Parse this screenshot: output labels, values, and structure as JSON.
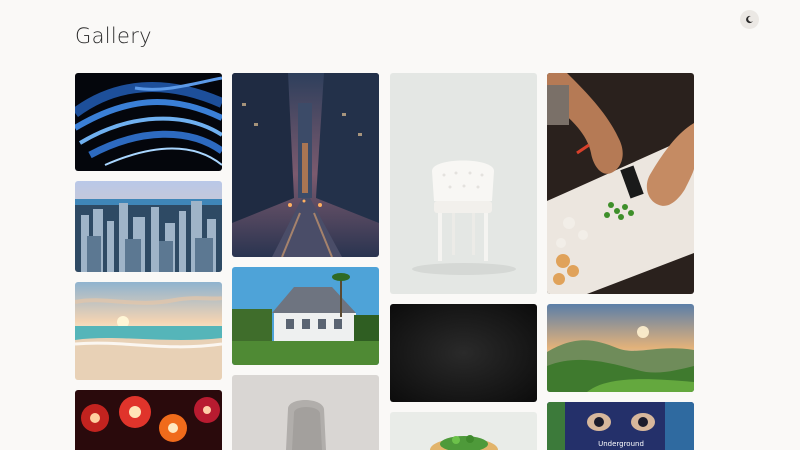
{
  "page": {
    "title": "Gallery"
  },
  "theme_toggle": {
    "icon": "moon-icon"
  },
  "street_art": {
    "sign_text": "Underground"
  }
}
